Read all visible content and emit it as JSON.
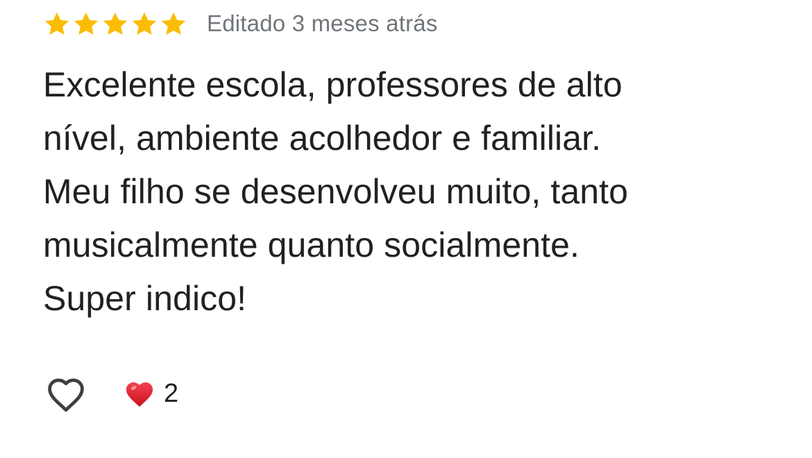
{
  "review": {
    "rating": 5,
    "rating_max": 5,
    "star_color": "#fbbc04",
    "edited_label": "Editado 3 meses atrás",
    "text_lines": [
      "Excelente escola, professores de alto",
      "nível, ambiente acolhedor e familiar.",
      "Meu filho se desenvolveu muito, tanto",
      "musicalmente quanto socialmente.",
      "Super indico!"
    ]
  },
  "actions": {
    "like_icon": "heart-outline-icon",
    "reaction_icon": "red-heart-icon",
    "reaction_color": "#e0212e",
    "reaction_count": "2"
  }
}
